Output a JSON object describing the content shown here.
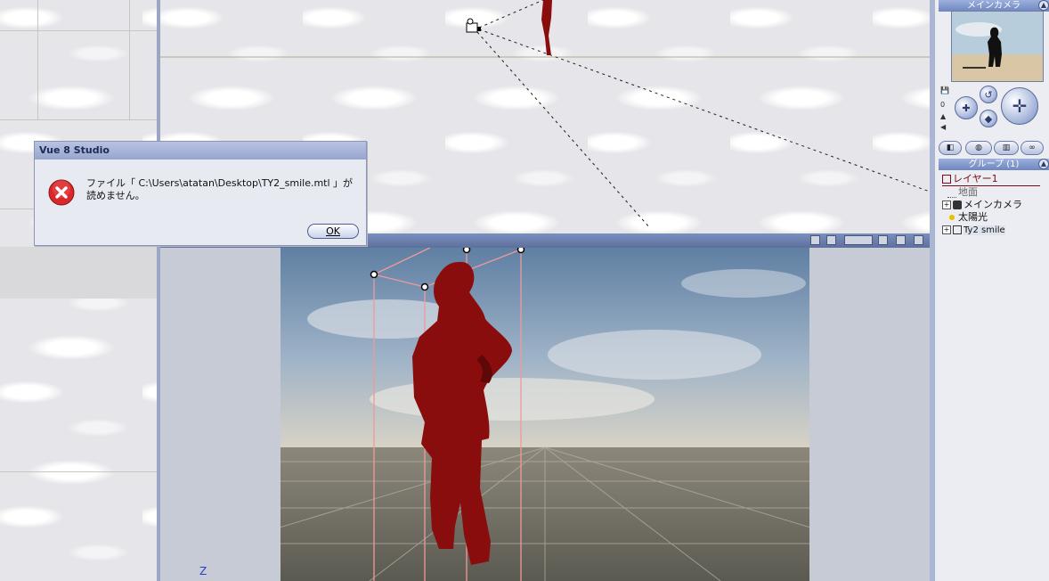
{
  "dialog": {
    "title": "Vue 8 Studio",
    "message": "ファイル「 C:\\Users\\atatan\\Desktop\\TY2_smile.mtl 」が読めません。",
    "ok_label": "OK",
    "icon": "error-icon"
  },
  "viewport_main": {
    "axis_label": "Z"
  },
  "right_panel": {
    "camera_panel_title": "メインカメラ",
    "camera_side_digit": "0",
    "group_title": "グループ (1)",
    "layer_label": "レイヤー1",
    "tree": [
      {
        "label": "地面",
        "icon": "ground-icon",
        "expandable": false
      },
      {
        "label": "メインカメラ",
        "icon": "camera-icon",
        "expandable": true
      },
      {
        "label": "太陽光",
        "icon": "sun-icon",
        "expandable": false
      },
      {
        "label": "Ty2 smile",
        "icon": "figure-icon",
        "expandable": true
      }
    ]
  },
  "colors": {
    "figure": "#8a0d0d",
    "accent": "#7186c0",
    "error": "#d9272b"
  }
}
